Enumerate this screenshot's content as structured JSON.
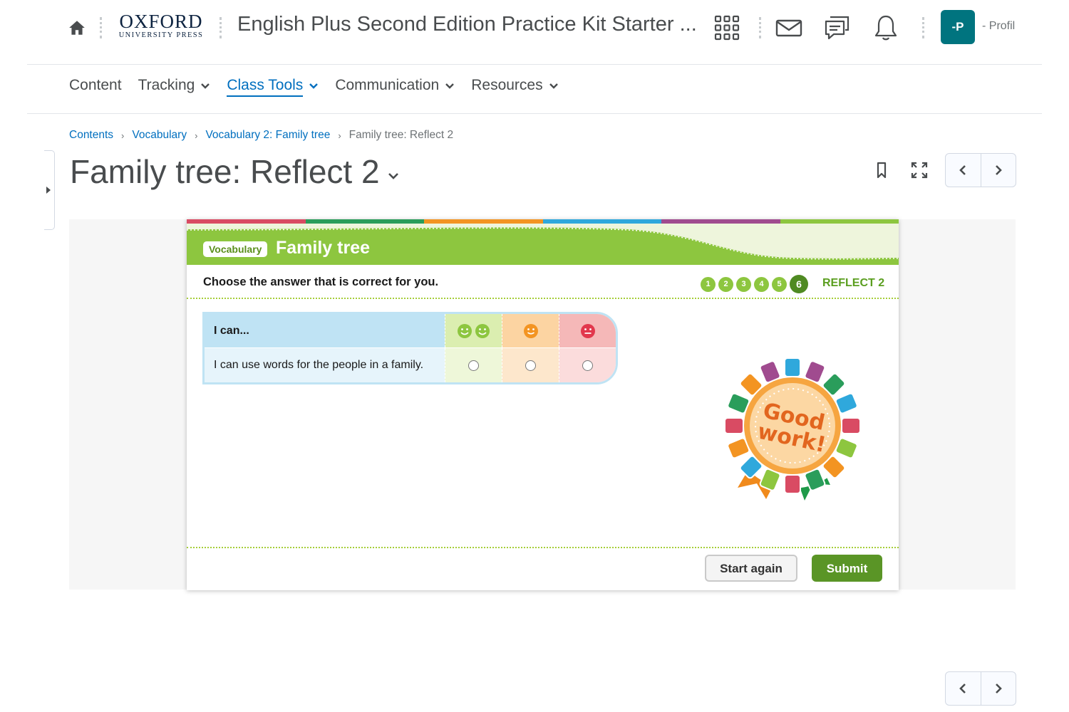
{
  "header": {
    "logo_main": "OXFORD",
    "logo_sub": "UNIVERSITY PRESS",
    "course_title": "English Plus Second Edition Practice Kit Starter ...",
    "avatar_initials": "-P",
    "profile_label": "- Profil",
    "icons": [
      "home-icon",
      "apps-grid-icon",
      "mail-icon",
      "chat-icon",
      "bell-icon"
    ]
  },
  "nav": {
    "items": [
      {
        "label": "Content",
        "has_menu": false
      },
      {
        "label": "Tracking",
        "has_menu": true
      },
      {
        "label": "Class Tools",
        "has_menu": true,
        "active": true
      },
      {
        "label": "Communication",
        "has_menu": true
      },
      {
        "label": "Resources",
        "has_menu": true
      }
    ]
  },
  "breadcrumb": {
    "links": [
      "Contents",
      "Vocabulary",
      "Vocabulary 2: Family tree"
    ],
    "current": "Family tree: Reflect 2",
    "separator": "›"
  },
  "page": {
    "title": "Family tree: Reflect 2"
  },
  "activity": {
    "stripe_colors": [
      "#d94b63",
      "#2a9d5b",
      "#f39422",
      "#2fa8dc",
      "#a04b8f",
      "#8dc63f"
    ],
    "banner_color": "#8dc63f",
    "category_chip": "Vocabulary",
    "title": "Family tree",
    "instruction": "Choose the answer that is correct for you.",
    "steps": [
      "1",
      "2",
      "3",
      "4",
      "5",
      "6"
    ],
    "current_step": "6",
    "reflect_label": "REFLECT 2",
    "table": {
      "header": "I can...",
      "row_statement": "I can use words for the people in a family.",
      "selected": null
    },
    "badge_text_line1": "Good",
    "badge_text_line2": "work!",
    "buttons": {
      "start_again": "Start again",
      "submit": "Submit"
    }
  }
}
